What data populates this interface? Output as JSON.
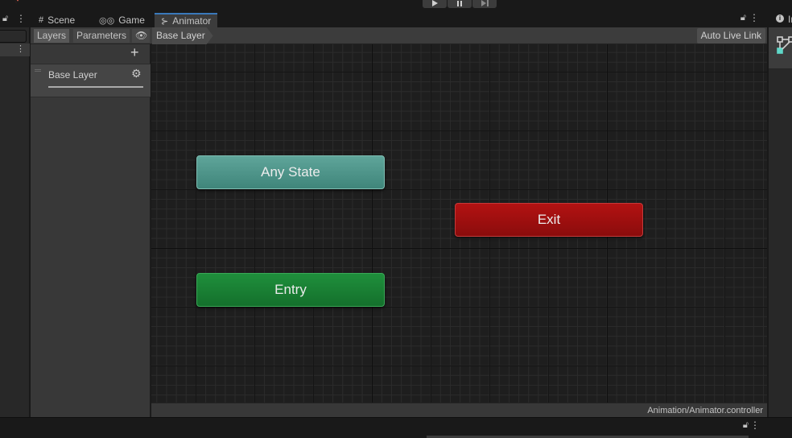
{
  "toolbar": {
    "play_icon": "play-icon",
    "pause_icon": "pause-icon",
    "step_icon": "step-icon"
  },
  "hierarchy": {
    "lock_icon": "lock-icon",
    "menu_icon": "kebab-menu-icon"
  },
  "tabs": [
    {
      "label": "Scene",
      "icon": "grid-icon"
    },
    {
      "label": "Game",
      "icon": "gamepad-icon"
    },
    {
      "label": "Animator",
      "icon": "animator-icon",
      "active": true
    }
  ],
  "animator": {
    "layers_tab": "Layers",
    "parameters_tab": "Parameters",
    "eye_icon": "eye-icon",
    "breadcrumb": "Base Layer",
    "auto_live_link": "Auto Live Link",
    "add_layer_icon": "plus-icon",
    "layers": [
      {
        "name": "Base Layer",
        "weight": 1.0,
        "settings_icon": "gear-icon"
      }
    ],
    "nodes": {
      "any_state": "Any State",
      "exit": "Exit",
      "entry": "Entry"
    },
    "status_path": "Animation/Animator.controller"
  },
  "inspector": {
    "label": "In",
    "icon": "info-icon",
    "header_icon": "state-machine-icon"
  },
  "colors": {
    "any_state": "#4f978c",
    "exit": "#a01010",
    "entry": "#188034",
    "tab_accent": "#3a79bb"
  }
}
